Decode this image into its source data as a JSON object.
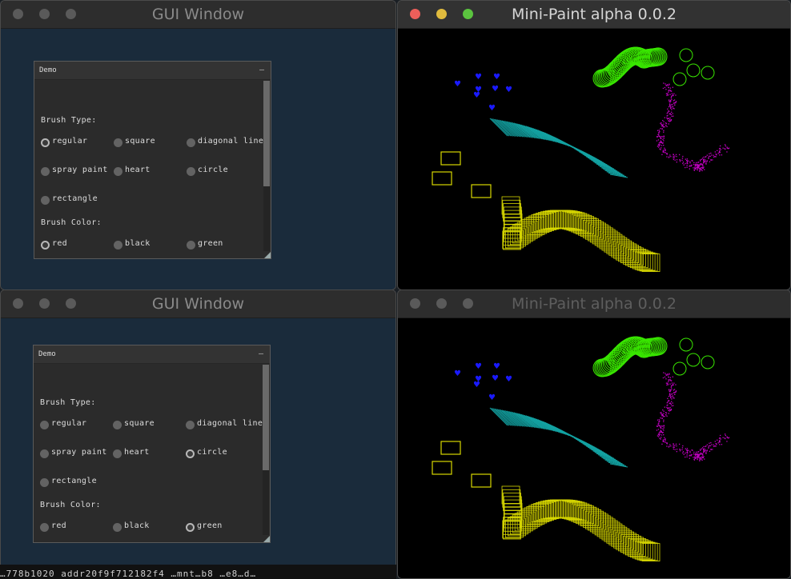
{
  "windows": {
    "gui_top": {
      "title": "GUI Window"
    },
    "paint_top": {
      "title": "Mini-Paint alpha 0.0.2"
    },
    "gui_bottom": {
      "title": "GUI Window"
    },
    "paint_bottom": {
      "title": "Mini-Paint alpha 0.0.2"
    }
  },
  "panel": {
    "title": "Demo",
    "collapse_symbol": "–",
    "brush_type_label": "Brush Type:",
    "brush_color_label": "Brush Color:",
    "brush_types": [
      "regular",
      "square",
      "diagonal line",
      "spray paint",
      "heart",
      "circle",
      "rectangle"
    ],
    "brush_colors": [
      "red",
      "black",
      "green"
    ]
  },
  "top_state": {
    "brush_type": "regular",
    "brush_color": "red"
  },
  "bottom_state": {
    "brush_type": "circle",
    "brush_color": "green"
  },
  "terminal": {
    "text": "…778b1020 addr20f9f712182f4 …mnt…b8 …e8…d…"
  },
  "colors": {
    "gui_bg": "#1a2b3b",
    "panel_bg": "#2b2b2b",
    "paint_bg": "#000000",
    "stroke_green": "#39e600",
    "stroke_magenta": "#c400c4",
    "stroke_teal": "#13a2a2",
    "stroke_yellow": "#d7d700",
    "heart_blue": "#1a1aff"
  }
}
